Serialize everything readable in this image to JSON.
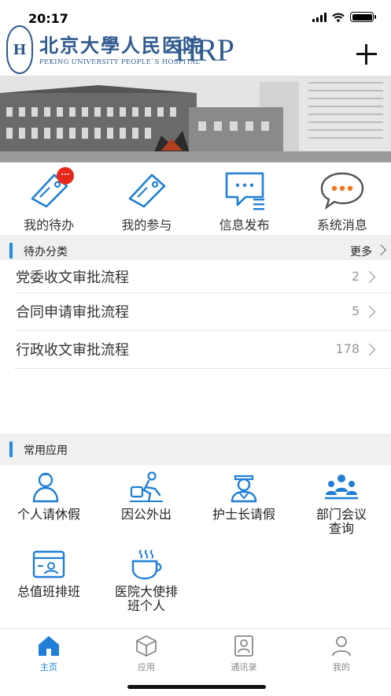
{
  "status_bar": {
    "time": "20:17"
  },
  "header": {
    "logo_seal_text": "H",
    "logo_cn": "北京大學人民医院",
    "logo_en": "PEKING UNIVERSITY PEOPLE`S HOSPITAL",
    "logo_hrp": "HRP"
  },
  "quick_actions": [
    {
      "label": "我的待办",
      "icon": "tag-icon",
      "badge": "..."
    },
    {
      "label": "我的参与",
      "icon": "tag-icon"
    },
    {
      "label": "信息发布",
      "icon": "message-list-icon"
    },
    {
      "label": "系统消息",
      "icon": "chat-bubble-icon"
    }
  ],
  "todo_section": {
    "title": "待办分类",
    "more_label": "更多",
    "items": [
      {
        "name": "党委收文审批流程",
        "count": "2"
      },
      {
        "name": "合同申请审批流程",
        "count": "5"
      },
      {
        "name": "行政收文审批流程",
        "count": "178"
      }
    ]
  },
  "apps_section": {
    "title": "常用应用",
    "apps": [
      {
        "label": "个人请休假",
        "icon": "person-leave-icon"
      },
      {
        "label": "因公外出",
        "icon": "business-trip-icon"
      },
      {
        "label": "护士长请假",
        "icon": "nurse-icon"
      },
      {
        "label": "部门会议\n查询",
        "icon": "meeting-icon"
      },
      {
        "label": "总值班排班",
        "icon": "schedule-icon"
      },
      {
        "label": "医院大使排\n班个人",
        "icon": "coffee-cup-icon"
      }
    ]
  },
  "tab_bar": [
    {
      "label": "主页",
      "icon": "home-icon",
      "active": true
    },
    {
      "label": "应用",
      "icon": "cube-icon",
      "active": false
    },
    {
      "label": "通讯录",
      "icon": "contacts-icon",
      "active": false
    },
    {
      "label": "我的",
      "icon": "user-icon",
      "active": false
    }
  ],
  "colors": {
    "accent": "#1f8de0",
    "icon_blue": "#1f7fd6",
    "badge_red": "#e8271b",
    "logo_blue": "#2f5a8f",
    "message_orange": "#f07a22"
  }
}
